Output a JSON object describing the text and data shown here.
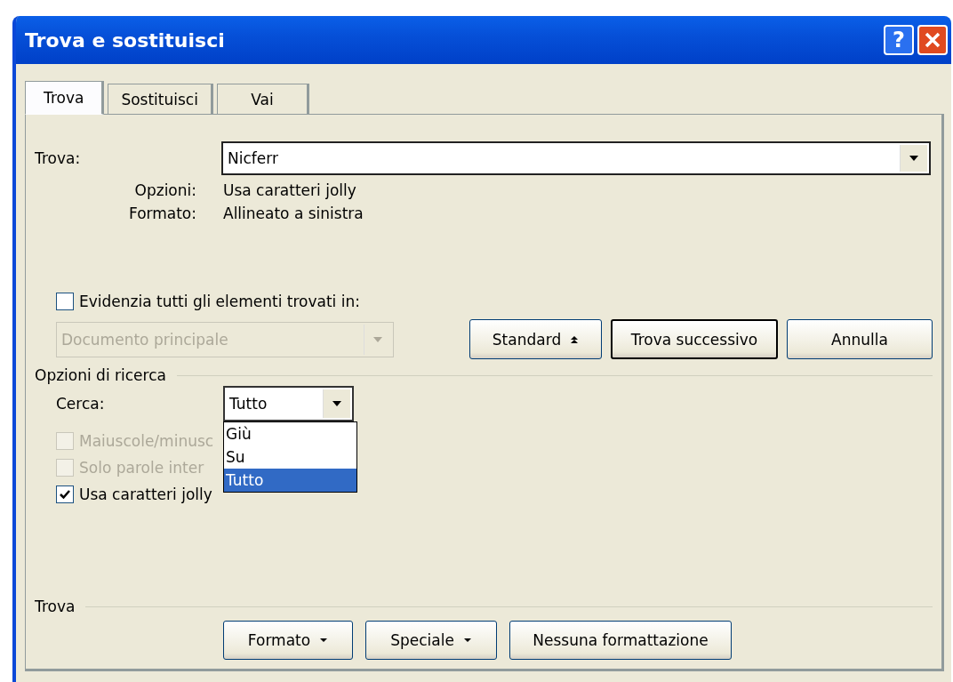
{
  "window": {
    "title": "Trova e sostituisci",
    "help": "?"
  },
  "tabs": [
    {
      "label": "Trova",
      "selected": true
    },
    {
      "label": "Sostituisci",
      "selected": false
    },
    {
      "label": "Vai",
      "selected": false
    }
  ],
  "find": {
    "label": "Trova:",
    "value": "Nicferr"
  },
  "info": [
    {
      "label": "Opzioni:",
      "value": "Usa caratteri jolly"
    },
    {
      "label": "Formato:",
      "value": "Allineato a sinistra"
    }
  ],
  "highlight": {
    "label": "Evidenzia tutti gli elementi trovati in:",
    "checked": false,
    "select": {
      "value": "Documento principale",
      "disabled": true
    }
  },
  "buttons": [
    {
      "label": "Standard",
      "kind": "collapse",
      "default": false
    },
    {
      "label": "Trova successivo",
      "kind": "plain",
      "default": true
    },
    {
      "label": "Annulla",
      "kind": "plain",
      "default": false
    }
  ],
  "search_options": {
    "title": "Opzioni di ricerca",
    "search": {
      "label": "Cerca:",
      "value": "Tutto",
      "expanded": true,
      "options": [
        {
          "label": "Giù",
          "selected": false
        },
        {
          "label": "Su",
          "selected": false
        },
        {
          "label": "Tutto",
          "selected": true
        }
      ]
    },
    "checkboxes": [
      {
        "label": "Maiuscole/minusc",
        "checked": false,
        "disabled": true
      },
      {
        "label": "Solo parole inter",
        "checked": false,
        "disabled": true
      },
      {
        "label": "Usa caratteri jolly",
        "checked": true,
        "disabled": false
      }
    ]
  },
  "footer": {
    "title": "Trova",
    "buttons": [
      {
        "label": "Formato",
        "kind": "menu"
      },
      {
        "label": "Speciale",
        "kind": "menu"
      },
      {
        "label": "Nessuna formattazione",
        "kind": "plain"
      }
    ]
  }
}
